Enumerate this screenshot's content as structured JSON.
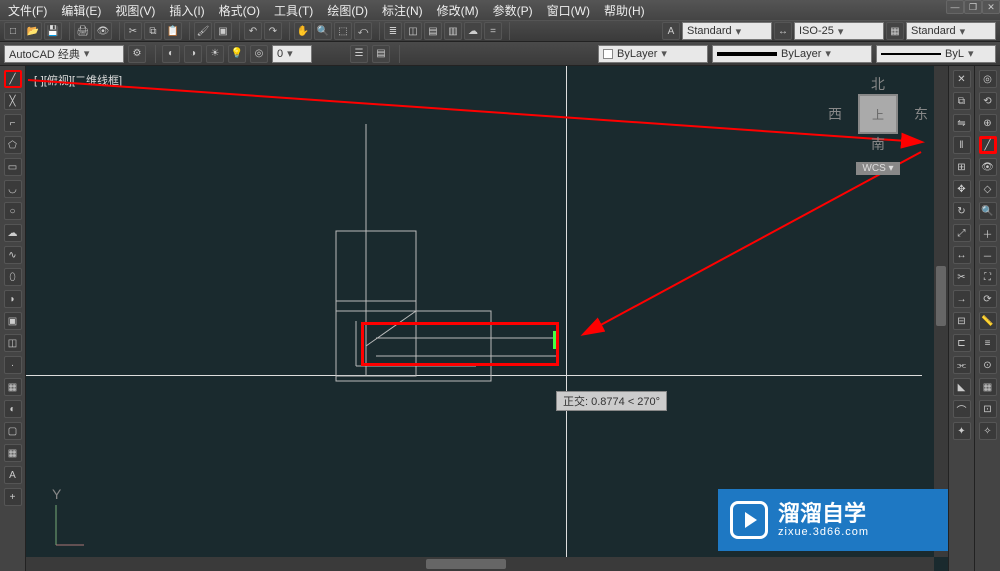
{
  "menu": {
    "file": "文件(F)",
    "edit": "编辑(E)",
    "view": "视图(V)",
    "insert": "插入(I)",
    "format": "格式(O)",
    "tools": "工具(T)",
    "draw": "绘图(D)",
    "dimension": "标注(N)",
    "modify": "修改(M)",
    "parametric": "参数(P)",
    "window": "窗口(W)",
    "help": "帮助(H)"
  },
  "workspace": {
    "name": "AutoCAD 经典"
  },
  "styles": {
    "text_style": "Standard",
    "dim_style": "ISO-25",
    "table_style": "Standard"
  },
  "layer": {
    "current": "ByLayer",
    "lineweight": "ByLayer",
    "plotstyle": "ByL"
  },
  "viewport": {
    "label": "[-][俯视][二维线框]"
  },
  "viewcube": {
    "north": "北",
    "south": "南",
    "east": "东",
    "west": "西",
    "top": "上",
    "system": "WCS"
  },
  "tooltip": {
    "text": "正交: 0.8774 < 270°"
  },
  "ucs": {
    "label": "Y"
  },
  "watermark": {
    "main": "溜溜自学",
    "sub": "zixue.3d66.com"
  },
  "icons": {
    "new": "□",
    "open": "📂",
    "save": "💾",
    "print": "🖨",
    "undo": "↶",
    "redo": "↷",
    "pan": "✋",
    "zoom": "🔍",
    "line": "╱",
    "circle": "○",
    "arc": "◡",
    "rect": "▭",
    "hatch": "▦",
    "text": "A",
    "dim": "↔",
    "table": "▦",
    "block": "▣",
    "point": "·",
    "pline": "⌐",
    "spline": "∿",
    "ellipse": "⬯",
    "erase": "✕",
    "copy": "⧉",
    "mirror": "⇋",
    "offset": "‖",
    "array": "⊞",
    "move": "✥",
    "rotate": "↻",
    "scale": "⤢",
    "trim": "✂",
    "extend": "→",
    "fillet": "⌒",
    "explode": "✦"
  }
}
